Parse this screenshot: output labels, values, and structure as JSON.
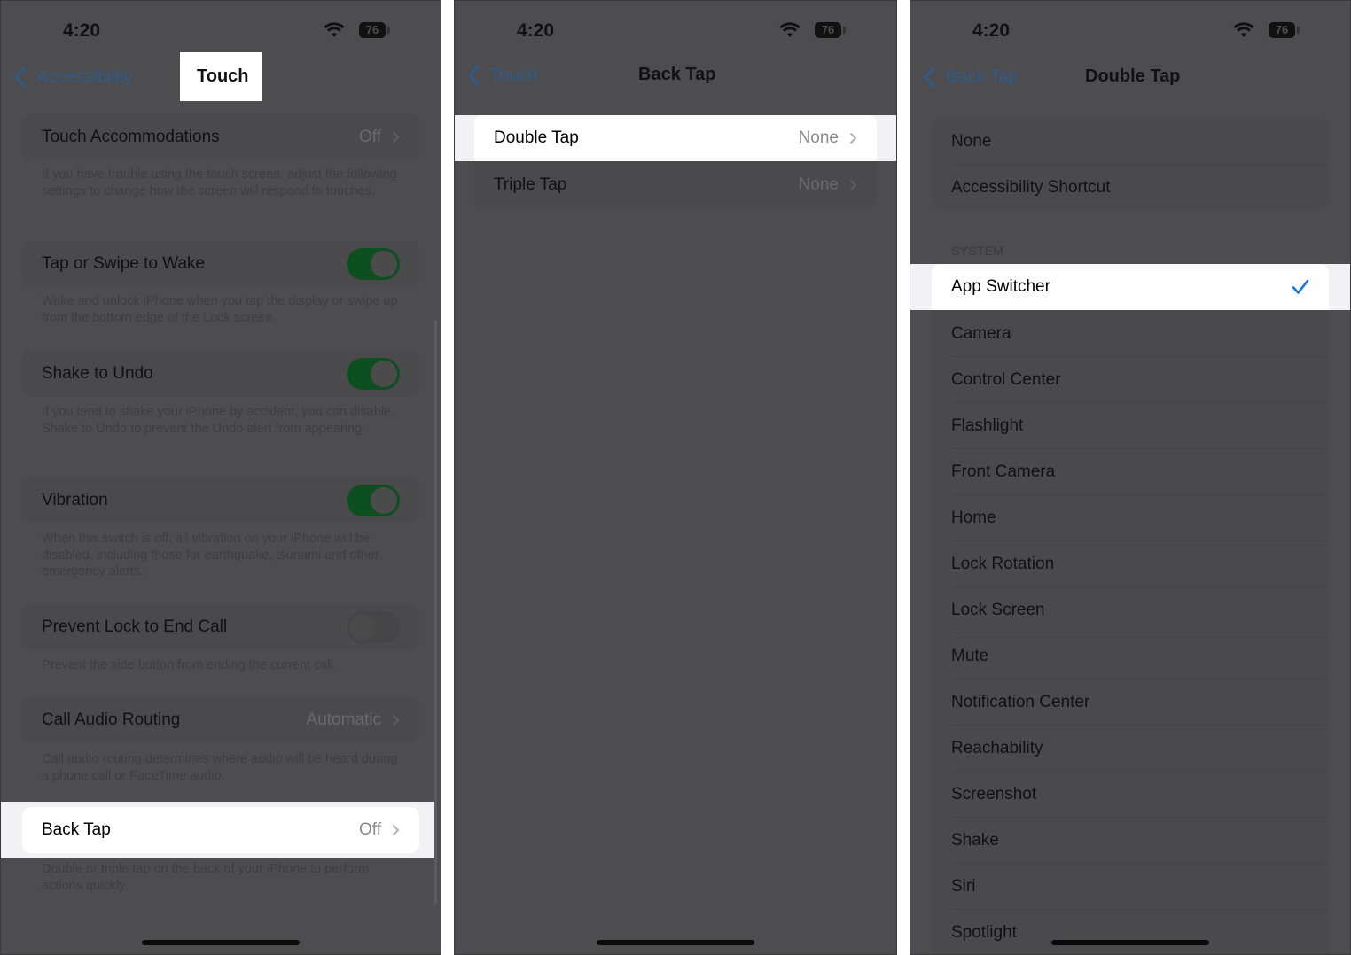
{
  "status_bar": {
    "time": "4:20",
    "battery": "76"
  },
  "colors": {
    "accent_blue": "#1a73e8",
    "toggle_on": "#0d4f1f",
    "dim_overlay": "#4d4d4f"
  },
  "panel1": {
    "back_label": "Accessibility",
    "title": "Touch",
    "rows": [
      {
        "label": "Touch Accommodations",
        "value": "Off",
        "footer": "If you have trouble using the touch screen, adjust the following settings to change how the screen will respond to touches."
      },
      {
        "label": "Tap or Swipe to Wake",
        "toggle": true,
        "footer": "Wake and unlock iPhone when you tap the display or swipe up from the bottom edge of the Lock screen."
      },
      {
        "label": "Shake to Undo",
        "toggle": true,
        "footer": "If you tend to shake your iPhone by accident, you can disable Shake to Undo to prevent the Undo alert from appearing."
      },
      {
        "label": "Vibration",
        "toggle": true,
        "footer": "When this switch is off, all vibration on your iPhone will be disabled, including those for earthquake, tsunami and other emergency alerts."
      },
      {
        "label": "Prevent Lock to End Call",
        "toggle": false,
        "footer": "Prevent the side button from ending the current call."
      },
      {
        "label": "Call Audio Routing",
        "value": "Automatic",
        "footer": "Call audio routing determines where audio will be heard during a phone call or FaceTime audio."
      },
      {
        "label": "Back Tap",
        "value": "Off",
        "footer": "Double or triple tap on the back of your iPhone to perform actions quickly."
      }
    ]
  },
  "panel2": {
    "back_label": "Touch",
    "title": "Back Tap",
    "rows": [
      {
        "label": "Double Tap",
        "value": "None"
      },
      {
        "label": "Triple Tap",
        "value": "None"
      }
    ]
  },
  "panel3": {
    "back_label": "Back Tap",
    "title": "Double Tap",
    "top_options": [
      "None",
      "Accessibility Shortcut"
    ],
    "section_header": "SYSTEM",
    "selected": "App Switcher",
    "system_options": [
      "App Switcher",
      "Camera",
      "Control Center",
      "Flashlight",
      "Front Camera",
      "Home",
      "Lock Rotation",
      "Lock Screen",
      "Mute",
      "Notification Center",
      "Reachability",
      "Screenshot",
      "Shake",
      "Siri",
      "Spotlight"
    ]
  }
}
